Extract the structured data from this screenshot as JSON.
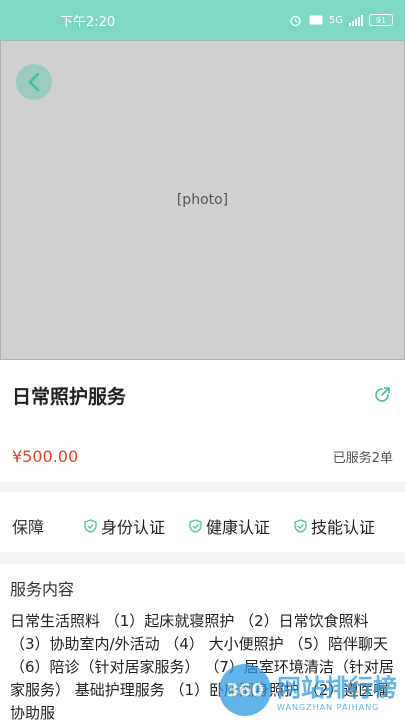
{
  "status_bar": {
    "time": "下午2:20",
    "network": "5G",
    "battery": "91"
  },
  "hero": {
    "image_label": "[photo]"
  },
  "service": {
    "title": "日常照护服务",
    "price": "¥500.00",
    "served": "已服务2单"
  },
  "guarantee": {
    "label": "保障",
    "items": [
      "身份认证",
      "健康认证",
      "技能认证"
    ]
  },
  "content": {
    "title": "服务内容",
    "body": "日常生活照料 （1）起床就寝照护 （2）日常饮食照料 （3）协助室内/外活动 （4） 大小便照护 （5）陪伴聊天 （6）陪诊（针对居家服务） （7）居室环境清洁（针对居家服务） 基础护理服务 （1）卧床翻身照护 （2）遵医嘱协助服"
  },
  "watermark": {
    "logo": "360",
    "title": "网站排行榜",
    "subtitle": "WANGZHAN PAIHANG"
  },
  "colors": {
    "accent": "#7fd8c4",
    "price": "#e5432b",
    "guarantee_icon": "#3cbfa3"
  }
}
